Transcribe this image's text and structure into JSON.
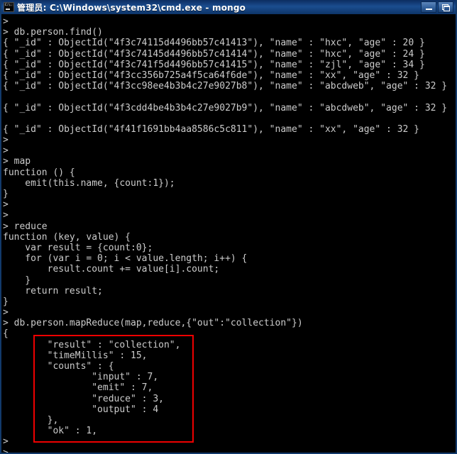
{
  "window": {
    "title": "管理员: C:\\Windows\\system32\\cmd.exe - mongo",
    "icon_name": "cmd-console-icon",
    "icon_label": "C:\\.",
    "minimize_label": "Minimize",
    "maximize_label": "Restore",
    "titlebar_color": "#1b4d8f",
    "background_color": "#000000",
    "text_color": "#cccccc"
  },
  "annotation": {
    "box_color": "#ee0000",
    "label": "mapreduce-result-highlight"
  },
  "console": {
    "prompt": ">",
    "lines": [
      ">",
      "> db.person.find()",
      "{ \"_id\" : ObjectId(\"4f3c74115d4496bb57c41413\"), \"name\" : \"hxc\", \"age\" : 20 }",
      "{ \"_id\" : ObjectId(\"4f3c74145d4496bb57c41414\"), \"name\" : \"hxc\", \"age\" : 24 }",
      "{ \"_id\" : ObjectId(\"4f3c741f5d4496bb57c41415\"), \"name\" : \"zjl\", \"age\" : 34 }",
      "{ \"_id\" : ObjectId(\"4f3cc356b725a4f5ca64f6de\"), \"name\" : \"xx\", \"age\" : 32 }",
      "{ \"_id\" : ObjectId(\"4f3cc98ee4b3b4c27e9027b8\"), \"name\" : \"abcdweb\", \"age\" : 32 }",
      "",
      "{ \"_id\" : ObjectId(\"4f3cdd4be4b3b4c27e9027b9\"), \"name\" : \"abcdweb\", \"age\" : 32 }",
      "",
      "{ \"_id\" : ObjectId(\"4f41f1691bb4aa8586c5c811\"), \"name\" : \"xx\", \"age\" : 32 }",
      ">",
      ">",
      "> map",
      "function () {",
      "    emit(this.name, {count:1});",
      "}",
      ">",
      ">",
      "> reduce",
      "function (key, value) {",
      "    var result = {count:0};",
      "    for (var i = 0; i < value.length; i++) {",
      "        result.count += value[i].count;",
      "    }",
      "    return result;",
      "}",
      ">",
      "> db.person.mapReduce(map,reduce,{\"out\":\"collection\"})",
      "{",
      "        \"result\" : \"collection\",",
      "        \"timeMillis\" : 15,",
      "        \"counts\" : {",
      "                \"input\" : 7,",
      "                \"emit\" : 7,",
      "                \"reduce\" : 3,",
      "                \"output\" : 4",
      "        },",
      "        \"ok\" : 1,",
      ">",
      ">"
    ]
  }
}
